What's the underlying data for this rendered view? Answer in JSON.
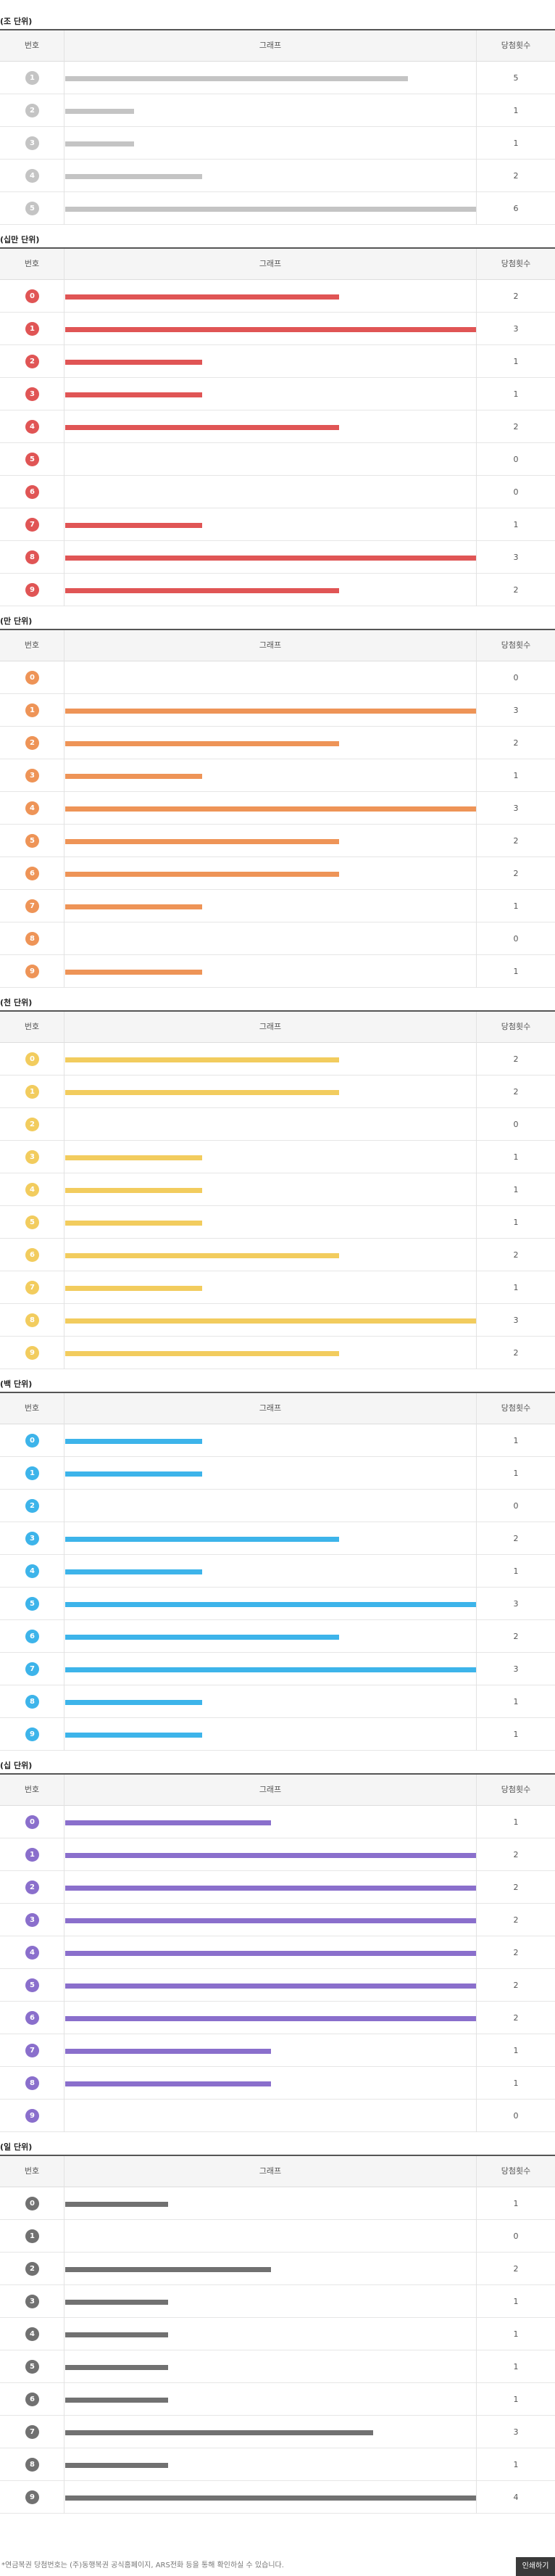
{
  "header": {
    "col_number": "번호",
    "col_graph": "그래프",
    "col_count": "당첨횟수"
  },
  "chart_data": [
    {
      "type": "bar",
      "title": "(조 단위)",
      "color": "#c4c4c4",
      "xlim": [
        0,
        6
      ],
      "categories": [
        "1",
        "2",
        "3",
        "4",
        "5"
      ],
      "values": [
        5,
        1,
        1,
        2,
        6
      ]
    },
    {
      "type": "bar",
      "title": "(십만 단위)",
      "color": "#e05555",
      "xlim": [
        0,
        3
      ],
      "categories": [
        "0",
        "1",
        "2",
        "3",
        "4",
        "5",
        "6",
        "7",
        "8",
        "9"
      ],
      "values": [
        2,
        3,
        1,
        1,
        2,
        0,
        0,
        1,
        3,
        2
      ]
    },
    {
      "type": "bar",
      "title": "(만 단위)",
      "color": "#ee9457",
      "xlim": [
        0,
        3
      ],
      "categories": [
        "0",
        "1",
        "2",
        "3",
        "4",
        "5",
        "6",
        "7",
        "8",
        "9"
      ],
      "values": [
        0,
        3,
        2,
        1,
        3,
        2,
        2,
        1,
        0,
        1
      ]
    },
    {
      "type": "bar",
      "title": "(천 단위)",
      "color": "#f2cc5e",
      "xlim": [
        0,
        3
      ],
      "categories": [
        "0",
        "1",
        "2",
        "3",
        "4",
        "5",
        "6",
        "7",
        "8",
        "9"
      ],
      "values": [
        2,
        2,
        0,
        1,
        1,
        1,
        2,
        1,
        3,
        2
      ]
    },
    {
      "type": "bar",
      "title": "(백 단위)",
      "color": "#3db4ea",
      "xlim": [
        0,
        3
      ],
      "categories": [
        "0",
        "1",
        "2",
        "3",
        "4",
        "5",
        "6",
        "7",
        "8",
        "9"
      ],
      "values": [
        1,
        1,
        0,
        2,
        1,
        3,
        2,
        3,
        1,
        1
      ]
    },
    {
      "type": "bar",
      "title": "(십 단위)",
      "color": "#8a6fcc",
      "xlim": [
        0,
        2
      ],
      "categories": [
        "0",
        "1",
        "2",
        "3",
        "4",
        "5",
        "6",
        "7",
        "8",
        "9"
      ],
      "values": [
        1,
        2,
        2,
        2,
        2,
        2,
        2,
        1,
        1,
        0
      ]
    },
    {
      "type": "bar",
      "title": "(일 단위)",
      "color": "#717171",
      "xlim": [
        0,
        4
      ],
      "categories": [
        "0",
        "1",
        "2",
        "3",
        "4",
        "5",
        "6",
        "7",
        "8",
        "9"
      ],
      "values": [
        1,
        0,
        2,
        1,
        1,
        1,
        1,
        3,
        1,
        4
      ]
    }
  ],
  "footer": {
    "note": "*연금복권 당첨번호는 (주)동행복권 공식홈페이지, ARS전화 등을 통해 확인하실 수 있습니다.",
    "print_button": "인쇄하기"
  }
}
